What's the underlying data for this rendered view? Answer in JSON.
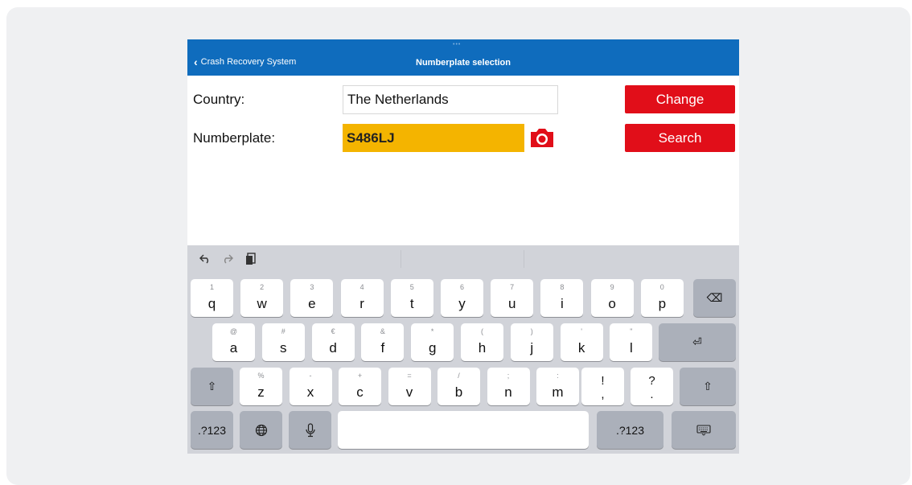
{
  "navbar": {
    "back_label": "Crash Recovery System",
    "title": "Numberplate selection",
    "status_dots": "•••"
  },
  "form": {
    "country_label": "Country:",
    "country_value": "The Netherlands",
    "numberplate_label": "Numberplate:",
    "numberplate_value": "S486LJ",
    "change_button": "Change",
    "search_button": "Search"
  },
  "colors": {
    "navbar": "#0f6cbd",
    "plate_field": "#f4b400",
    "button_red": "#e10e19",
    "keyboard_bg": "#d1d3d9"
  },
  "toolbar": {
    "icons": [
      "undo-icon",
      "redo-icon",
      "paste-icon"
    ]
  },
  "keyboard": {
    "row1": [
      {
        "main": "q",
        "hint": "1"
      },
      {
        "main": "w",
        "hint": "2"
      },
      {
        "main": "e",
        "hint": "3"
      },
      {
        "main": "r",
        "hint": "4"
      },
      {
        "main": "t",
        "hint": "5"
      },
      {
        "main": "y",
        "hint": "6"
      },
      {
        "main": "u",
        "hint": "7"
      },
      {
        "main": "i",
        "hint": "8"
      },
      {
        "main": "o",
        "hint": "9"
      },
      {
        "main": "p",
        "hint": "0"
      }
    ],
    "row2": [
      {
        "main": "a",
        "hint": "@"
      },
      {
        "main": "s",
        "hint": "#"
      },
      {
        "main": "d",
        "hint": "€"
      },
      {
        "main": "f",
        "hint": "&"
      },
      {
        "main": "g",
        "hint": "*"
      },
      {
        "main": "h",
        "hint": "("
      },
      {
        "main": "j",
        "hint": ")"
      },
      {
        "main": "k",
        "hint": "'"
      },
      {
        "main": "l",
        "hint": "\""
      }
    ],
    "row3": [
      {
        "main": "z",
        "hint": "%"
      },
      {
        "main": "x",
        "hint": "-"
      },
      {
        "main": "c",
        "hint": "+"
      },
      {
        "main": "v",
        "hint": "="
      },
      {
        "main": "b",
        "hint": "/"
      },
      {
        "main": "n",
        "hint": ";"
      },
      {
        "main": "m",
        "hint": ":"
      }
    ],
    "punct1": {
      "top": "!",
      "bottom": ","
    },
    "punct2": {
      "top": "?",
      "bottom": "."
    },
    "numbers_label": ".?123",
    "delete_glyph": "⌫",
    "return_glyph": "⏎",
    "shift_glyph": "⇧"
  }
}
